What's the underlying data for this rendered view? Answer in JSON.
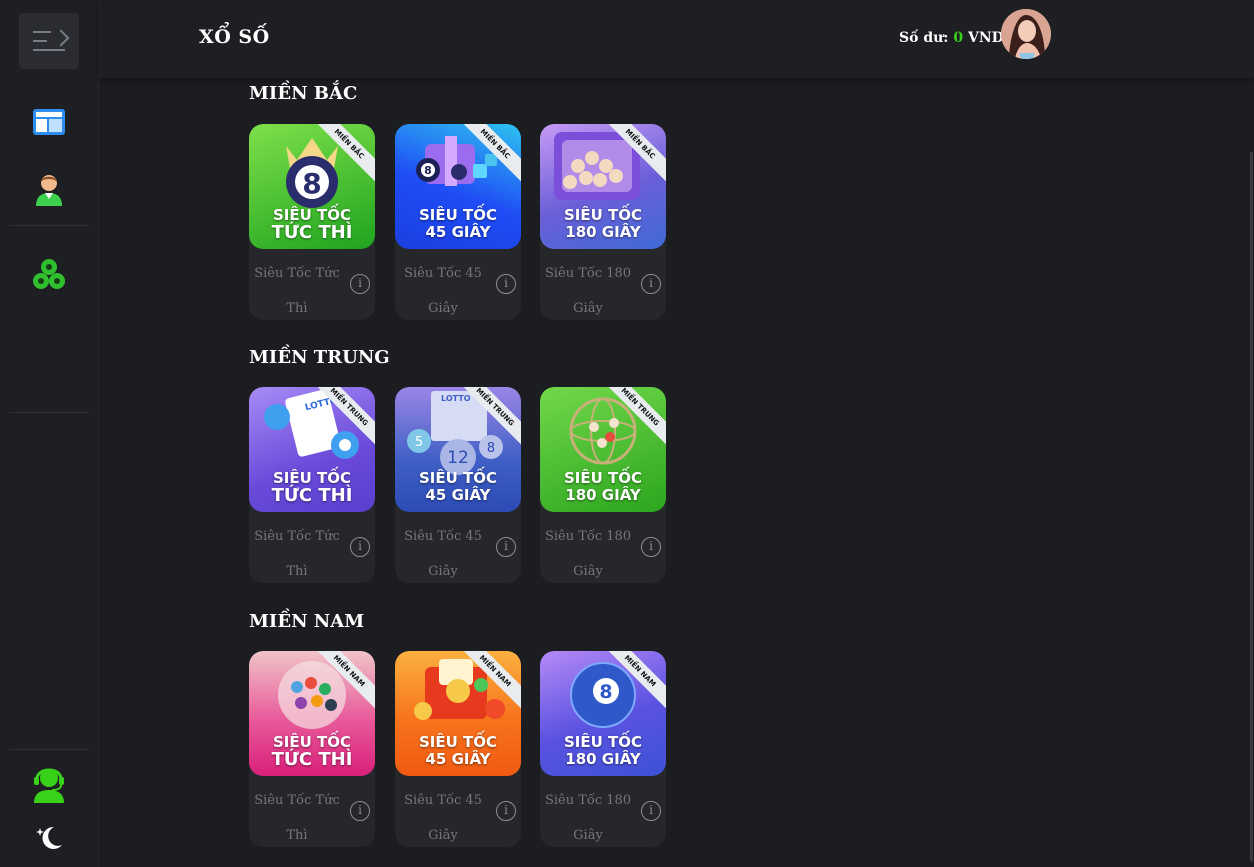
{
  "header": {
    "title": "XỔ SỐ",
    "balance_label": "Số dư:",
    "balance_amount": "0",
    "currency": "VND"
  },
  "sidebar": {
    "items": [
      "menu-toggle-icon",
      "dashboard-icon",
      "profile-icon",
      "lottery-balls-icon",
      "support-agent-icon",
      "theme-moon-icon"
    ]
  },
  "colors": {
    "accent": "#39d119",
    "background": "#1c1d21",
    "card": "#26272b"
  },
  "sections": [
    {
      "title": "MIỀN BẮC",
      "games": [
        {
          "ribbon": "MIỀN BẮC",
          "line1": "SIÊU TỐC",
          "line2": "TỨC THÌ",
          "name_a": "Siêu Tốc Tức",
          "name_b": "Thì"
        },
        {
          "ribbon": "MIỀN BẮC",
          "line1": "SIÊU TỐC",
          "line2": "45 GIÂY",
          "name_a": "Siêu Tốc 45",
          "name_b": "Giây"
        },
        {
          "ribbon": "MIỀN BẮC",
          "line1": "SIÊU TỐC",
          "line2": "180 GIÂY",
          "name_a": "Siêu Tốc 180",
          "name_b": "Giây"
        }
      ]
    },
    {
      "title": "MIỀN TRUNG",
      "games": [
        {
          "ribbon": "MIỀN TRUNG",
          "line1": "SIÊU TỐC",
          "line2": "TỨC THÌ",
          "name_a": "Siêu Tốc Tức",
          "name_b": "Thì"
        },
        {
          "ribbon": "MIỀN TRUNG",
          "line1": "SIÊU TỐC",
          "line2": "45 GIÂY",
          "name_a": "Siêu Tốc 45",
          "name_b": "Giây"
        },
        {
          "ribbon": "MIỀN TRUNG",
          "line1": "SIÊU TỐC",
          "line2": "180 GIÂY",
          "name_a": "Siêu Tốc 180",
          "name_b": "Giây"
        }
      ]
    },
    {
      "title": "MIỀN NAM",
      "games": [
        {
          "ribbon": "MIỀN NAM",
          "line1": "SIÊU TỐC",
          "line2": "TỨC THÌ",
          "name_a": "Siêu Tốc Tức",
          "name_b": "Thì"
        },
        {
          "ribbon": "MIỀN NAM",
          "line1": "SIÊU TỐC",
          "line2": "45 GIÂY",
          "name_a": "Siêu Tốc 45",
          "name_b": "Giây"
        },
        {
          "ribbon": "MIỀN NAM",
          "line1": "SIÊU TỐC",
          "line2": "180 GIÂY",
          "name_a": "Siêu Tốc 180",
          "name_b": "Giây"
        }
      ]
    }
  ],
  "info_glyph": "i"
}
